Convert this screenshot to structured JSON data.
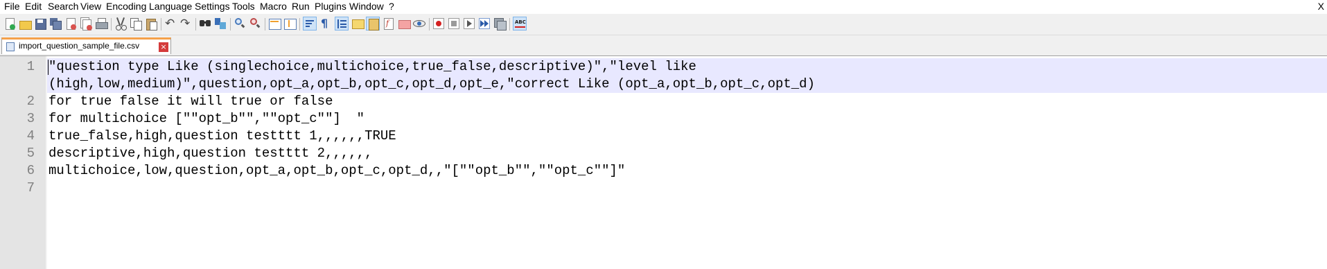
{
  "menu": [
    "File",
    "Edit",
    "Search",
    "View",
    "Encoding",
    "Language",
    "Settings",
    "Tools",
    "Macro",
    "Run",
    "Plugins",
    "Window",
    "?"
  ],
  "window_close": "X",
  "toolbar_icons": [
    "new-file-icon",
    "open-file-icon",
    "save-icon",
    "save-all-icon",
    "close-icon",
    "close-all-icon",
    "print-icon",
    "cut-icon",
    "copy-icon",
    "paste-icon",
    "undo-icon",
    "redo-icon",
    "find-icon",
    "replace-icon",
    "zoom-in-icon",
    "zoom-out-icon",
    "sync-vertical-icon",
    "sync-horizontal-icon",
    "word-wrap-icon",
    "show-all-chars-icon",
    "indent-guide-icon",
    "user-language-icon",
    "document-map-icon",
    "function-list-icon",
    "folder-workspace-icon",
    "monitoring-icon",
    "record-macro-icon",
    "stop-record-icon",
    "play-macro-icon",
    "run-macro-multiple-icon",
    "save-macro-icon",
    "spell-check-icon"
  ],
  "tab": {
    "label": "import_question_sample_file.csv",
    "close": "×"
  },
  "editor": {
    "line_numbers": [
      "1",
      "",
      "2",
      "3",
      "4",
      "5",
      "6",
      "7"
    ],
    "lines": [
      "\"question type Like (singlechoice,multichoice,true_false,descriptive)\",\"level like",
      "(high,low,medium)\",question,opt_a,opt_b,opt_c,opt_d,opt_e,\"correct Like (opt_a,opt_b,opt_c,opt_d)",
      "for true false it will true or false",
      "for multichoice [\"\"opt_b\"\",\"\"opt_c\"\"]  \"",
      "true_false,high,question testttt 1,,,,,,TRUE",
      "descriptive,high,question testttt 2,,,,,,",
      "multichoice,low,question,opt_a,opt_b,opt_c,opt_d,,\"[\"\"opt_b\"\",\"\"opt_c\"\"]\"",
      ""
    ]
  },
  "colors": {
    "tab_accent": "#f5a14a",
    "current_line": "#e8e8ff",
    "gutter": "#e4e4e4"
  }
}
